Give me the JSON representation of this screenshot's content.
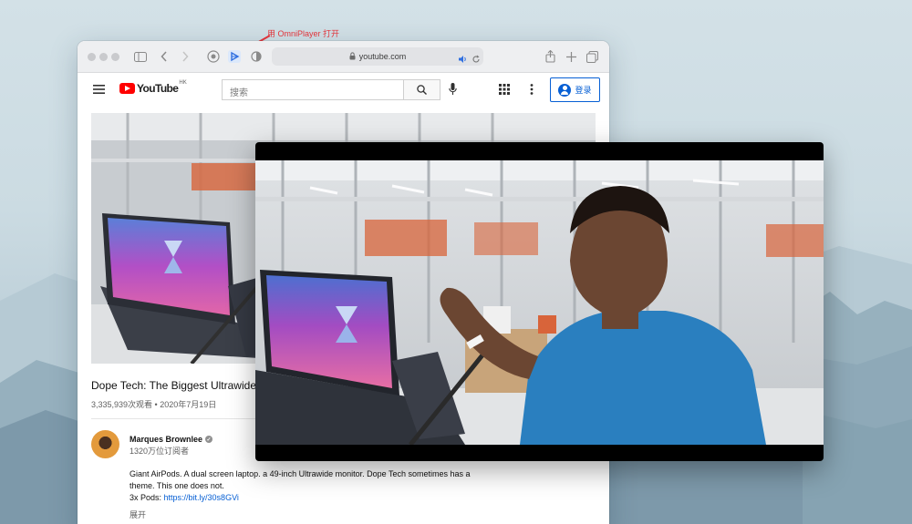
{
  "annotation": {
    "text": "用 OmniPlayer 打开",
    "color": "#e8343a"
  },
  "browser": {
    "url": "youtube.com",
    "toolbar_icons": [
      "sidebar-icon",
      "back-icon",
      "forward-icon",
      "privacy-icon",
      "omniplayer-icon",
      "shield-icon",
      "lock-icon",
      "audio-icon",
      "reload-icon",
      "share-icon",
      "new-tab-icon",
      "tabs-overview-icon"
    ]
  },
  "youtube": {
    "logo_text": "YouTube",
    "region": "HK",
    "search_placeholder": "搜索",
    "login_label": "登录",
    "accent": "#ff0000",
    "link_color": "#065fd4"
  },
  "video": {
    "title": "Dope Tech: The Biggest Ultrawide M",
    "meta": "3,335,939次观看 • 2020年7月19日",
    "channel": "Marques Brownlee",
    "subscribers": "1320万位订阅者",
    "description_line1": "Giant AirPods. A dual screen laptop. a 49-inch Ultrawide monitor. Dope Tech sometimes has a",
    "description_line2": "theme. This one does not.",
    "pods_label": "3x Pods: ",
    "pods_link": "https://bit.ly/30s8GVi",
    "expand_label": "展开"
  }
}
